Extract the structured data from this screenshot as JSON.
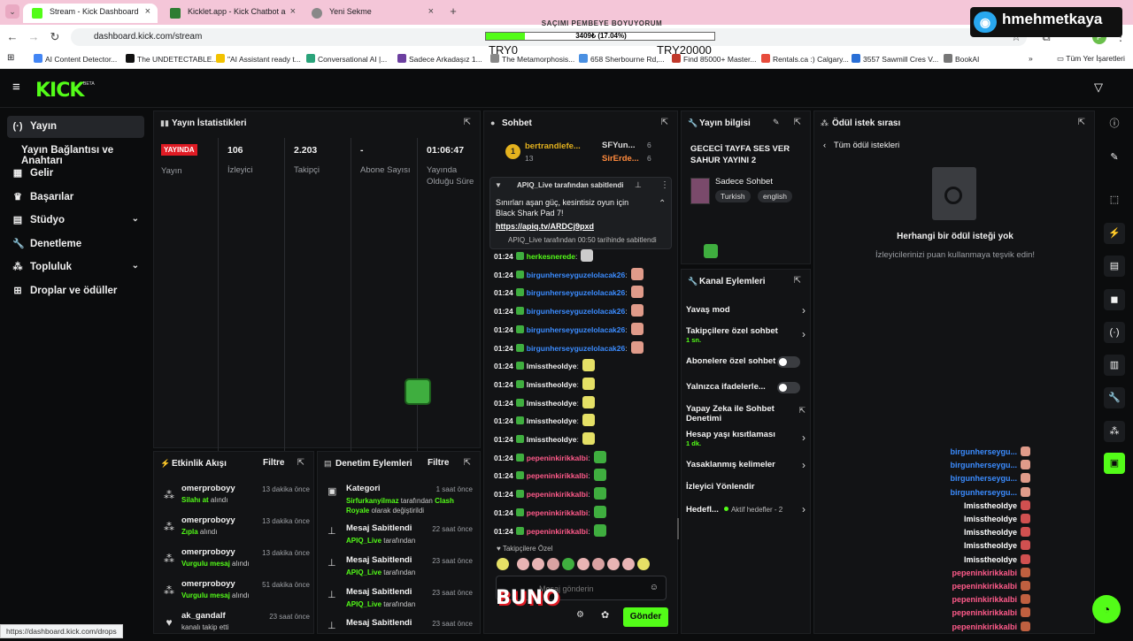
{
  "browser": {
    "tabs": [
      {
        "title": "Stream - Kick Dashboard",
        "active": true,
        "favicon_color": "#53fc18"
      },
      {
        "title": "Kicklet.app - Kick Chatbot a",
        "active": false,
        "favicon_color": "#2e7d32"
      },
      {
        "title": "Yeni Sekme",
        "active": false,
        "favicon_color": "#888888"
      }
    ],
    "url": "dashboard.kick.com/stream",
    "bookmarks": [
      "AI Content Detector...",
      "The UNDETECTABLE...",
      "\"AI Assistant ready t...",
      "Conversational AI |...",
      "Sadece Arkadaşız 1...",
      "The Metamorphosis...",
      "658 Sherbourne Rd,...",
      "Find 85000+ Master...",
      "Rentals.ca :) Calgary...",
      "3557 Sawmill Cres V...",
      "BookAI"
    ],
    "bookmarks_folder": "Tüm Yer İşaretleri",
    "status_url": "https://dashboard.kick.com/drops"
  },
  "overlay": {
    "goal_title": "SAÇIMI PEMBEYE BOYUYORUM",
    "goal_text": "3409₺ (17.04%)",
    "goal_fraction": 0.1704,
    "goal_min": "TRY0",
    "goal_max": "TRY20000",
    "streamer": "hmehmetkaya"
  },
  "kick": {
    "logo": "KICK",
    "beta": "BETA"
  },
  "sidebar": {
    "items": [
      {
        "label": "Yayın",
        "icon": "broadcast-icon",
        "glyph": "(·)",
        "active": true
      },
      {
        "label": "Yayın Bağlantısı ve Anahtarı",
        "icon": "",
        "glyph": "",
        "active": false
      },
      {
        "label": "Gelir",
        "icon": "revenue-icon",
        "glyph": "▦",
        "active": false
      },
      {
        "label": "Başarılar",
        "icon": "trophy-icon",
        "glyph": "♛",
        "active": false
      },
      {
        "label": "Stüdyo",
        "icon": "studio-icon",
        "glyph": "▤",
        "active": false,
        "chevron": "⌄"
      },
      {
        "label": "Denetleme",
        "icon": "wrench-icon",
        "glyph": "🔧",
        "active": false
      },
      {
        "label": "Topluluk",
        "icon": "community-icon",
        "glyph": "⁂",
        "active": false,
        "chevron": "⌄"
      },
      {
        "label": "Droplar ve ödüller",
        "icon": "drops-icon",
        "glyph": "⊞",
        "active": false
      }
    ]
  },
  "stats": {
    "title": "Yayın İstatistikleri",
    "live_badge": "YAYINDA",
    "live_label": "Yayın",
    "columns": [
      {
        "value": "106",
        "label": "İzleyici"
      },
      {
        "value": "2.203",
        "label": "Takipçi"
      },
      {
        "value": "-",
        "label": "Abone Sayısı"
      },
      {
        "value": "01:06:47",
        "label": "Yayında Olduğu Süre"
      }
    ]
  },
  "chat": {
    "title": "Sohbet",
    "top_gifters": [
      {
        "rank": "1",
        "name": "bertrandlefe...",
        "count": "13"
      },
      {
        "name": "SFYun...",
        "count": "6"
      },
      {
        "name": "SirErde...",
        "count": "6"
      }
    ],
    "pinned": {
      "by_line": "APIQ_Live tarafından sabitlendi",
      "text": "Sınırları aşan güç, kesintisiz oyun için Black Shark Pad 7!",
      "link": "https://apiq.tv/ARDCj9pxd",
      "footer": "APIQ_Live tarafından 00:50 tarihinde sabitlendi"
    },
    "messages": [
      {
        "time": "01:24",
        "user": "herkesneredе",
        "color": "#53fc18",
        "emote": "#cccccc"
      },
      {
        "time": "01:24",
        "user": "birgunherseyguzelolacak26",
        "color": "#3b8cff",
        "emote": "#e09b8a"
      },
      {
        "time": "01:24",
        "user": "birgunherseyguzelolacak26",
        "color": "#3b8cff",
        "emote": "#e09b8a"
      },
      {
        "time": "01:24",
        "user": "birgunherseyguzelolacak26",
        "color": "#3b8cff",
        "emote": "#e09b8a"
      },
      {
        "time": "01:24",
        "user": "birgunherseyguzelolacak26",
        "color": "#3b8cff",
        "emote": "#e09b8a"
      },
      {
        "time": "01:24",
        "user": "birgunherseyguzelolacak26",
        "color": "#3b8cff",
        "emote": "#e09b8a"
      },
      {
        "time": "01:24",
        "user": "lmisstheoldye",
        "color": "#f2f2f2",
        "emote": "#e5e066"
      },
      {
        "time": "01:24",
        "user": "lmisstheoldye",
        "color": "#f2f2f2",
        "emote": "#e5e066"
      },
      {
        "time": "01:24",
        "user": "lmisstheoldye",
        "color": "#f2f2f2",
        "emote": "#e5e066"
      },
      {
        "time": "01:24",
        "user": "lmisstheoldye",
        "color": "#f2f2f2",
        "emote": "#e5e066"
      },
      {
        "time": "01:24",
        "user": "lmisstheoldye",
        "color": "#f2f2f2",
        "emote": "#e5e066"
      },
      {
        "time": "01:24",
        "user": "pepeninkirikkalbi",
        "color": "#ff5a8a",
        "emote": "#3fae3f"
      },
      {
        "time": "01:24",
        "user": "pepeninkirikkalbi",
        "color": "#ff5a8a",
        "emote": "#3fae3f"
      },
      {
        "time": "01:24",
        "user": "pepeninkirikkalbi",
        "color": "#ff5a8a",
        "emote": "#3fae3f"
      },
      {
        "time": "01:24",
        "user": "pepeninkirikkalbi",
        "color": "#ff5a8a",
        "emote": "#3fae3f"
      },
      {
        "time": "01:24",
        "user": "pepeninkirikkalbi",
        "color": "#ff5a8a",
        "emote": "#3fae3f"
      }
    ],
    "follower_only_label": "Takipçilere Özel",
    "input_placeholder": "Mesaj gönderin",
    "send_label": "Gönder"
  },
  "stream_info": {
    "title": "Yayın bilgisi",
    "stream_title": "GECECİ TAYFA SES VER SAHUR YAYINI 2",
    "category": "Sadece Sohbet",
    "tags": [
      "Turkish",
      "english"
    ]
  },
  "channel_actions": {
    "title": "Kanal Eylemleri",
    "items": [
      {
        "label": "Yavaş mod",
        "sub": "",
        "control": "chevron"
      },
      {
        "label": "Takipçilere özel sohbet",
        "sub": "1 sn.",
        "control": "chevron"
      },
      {
        "label": "Abonelere özel sohbet",
        "sub": "",
        "control": "toggle"
      },
      {
        "label": "Yalnızca ifadelerle...",
        "sub": "",
        "control": "toggle"
      },
      {
        "label": "Yapay Zeka ile Sohbet Denetimi",
        "sub": "",
        "control": "external"
      },
      {
        "label": "Hesap yaşı kısıtlaması",
        "sub": "1 dk.",
        "control": "chevron"
      },
      {
        "label": "Yasaklanmış kelimeler",
        "sub": "",
        "control": "chevron"
      },
      {
        "label": "İzleyici Yönlendir",
        "sub": "",
        "control": "none"
      },
      {
        "label": "Hedefl...",
        "sub": "",
        "control": "chevron",
        "extra": "Aktif hedefler - 2"
      }
    ]
  },
  "rewards": {
    "title": "Ödül istek sırası",
    "back_label": "Tüm ödül istekleri",
    "empty_title": "Herhangi bir ödül isteği yok",
    "empty_sub": "İzleyicilerinizi puan kullanmaya teşvik edin!"
  },
  "activity": {
    "title": "Etkinlik Akışı",
    "filter": "Filtre",
    "items": [
      {
        "name": "omerproboyy",
        "time": "13 dakika önce",
        "reward": "Silahı at",
        "suffix": " alındı"
      },
      {
        "name": "omerproboyy",
        "time": "13 dakika önce",
        "reward": "Zıpla",
        "suffix": " alındı"
      },
      {
        "name": "omerproboyy",
        "time": "13 dakika önce",
        "reward": "Vurgulu mesaj",
        "suffix": " alındı"
      },
      {
        "name": "omerproboyy",
        "time": "51 dakika önce",
        "reward": "Vurgulu mesaj",
        "suffix": " alındı"
      },
      {
        "name": "ak_gandalf",
        "time": "23 saat önce",
        "reward": "",
        "suffix": "kanalı takip etti"
      }
    ]
  },
  "moderation": {
    "title": "Denetim Eylemleri",
    "filter": "Filtre",
    "items": [
      {
        "title": "Kategori",
        "time": "1 saat önce",
        "who": "Sirfurkanyilmaz",
        "mid": " tarafından ",
        "what": "Clash Royale",
        "end": " olarak değiştirildi"
      },
      {
        "title": "Mesaj Sabitlendi",
        "time": "22 saat önce",
        "who": "APIQ_Live",
        "mid": " tarafından",
        "what": "",
        "end": ""
      },
      {
        "title": "Mesaj Sabitlendi",
        "time": "23 saat önce",
        "who": "APIQ_Live",
        "mid": " tarafından",
        "what": "",
        "end": ""
      },
      {
        "title": "Mesaj Sabitlendi",
        "time": "23 saat önce",
        "who": "APIQ_Live",
        "mid": " tarafından",
        "what": "",
        "end": ""
      },
      {
        "title": "Mesaj Sabitlendi",
        "time": "23 saat önce",
        "who": "",
        "mid": "",
        "what": "",
        "end": ""
      }
    ]
  },
  "overlay_chat": [
    {
      "user": "birgunherseygu...",
      "color": "#3b8cff",
      "emote": "#e09b8a"
    },
    {
      "user": "birgunherseygu...",
      "color": "#3b8cff",
      "emote": "#e09b8a"
    },
    {
      "user": "birgunherseygu...",
      "color": "#3b8cff",
      "emote": "#e09b8a"
    },
    {
      "user": "birgunherseygu...",
      "color": "#3b8cff",
      "emote": "#e09b8a"
    },
    {
      "user": "lmisstheoldye",
      "color": "#ffffff",
      "emote": "#d05050"
    },
    {
      "user": "lmisstheoldye",
      "color": "#ffffff",
      "emote": "#d05050"
    },
    {
      "user": "lmisstheoldye",
      "color": "#ffffff",
      "emote": "#d05050"
    },
    {
      "user": "lmisstheoldye",
      "color": "#ffffff",
      "emote": "#d05050"
    },
    {
      "user": "lmisstheoldye",
      "color": "#ffffff",
      "emote": "#d05050"
    },
    {
      "user": "pepeninkirikkalbi",
      "color": "#ff5a8a",
      "emote": "#c06040"
    },
    {
      "user": "pepeninkirikkalbi",
      "color": "#ff5a8a",
      "emote": "#c06040"
    },
    {
      "user": "pepeninkirikkalbi",
      "color": "#ff5a8a",
      "emote": "#c06040"
    },
    {
      "user": "pepeninkirikkalbi",
      "color": "#ff5a8a",
      "emote": "#c06040"
    },
    {
      "user": "pepeninkirikkalbi",
      "color": "#ff5a8a",
      "emote": "#c06040"
    }
  ],
  "buno_logo": "BUNO",
  "colors": {
    "accent": "#53fc18",
    "live": "#e01b24",
    "bg": "#0b0c0d",
    "panel": "#121315"
  }
}
